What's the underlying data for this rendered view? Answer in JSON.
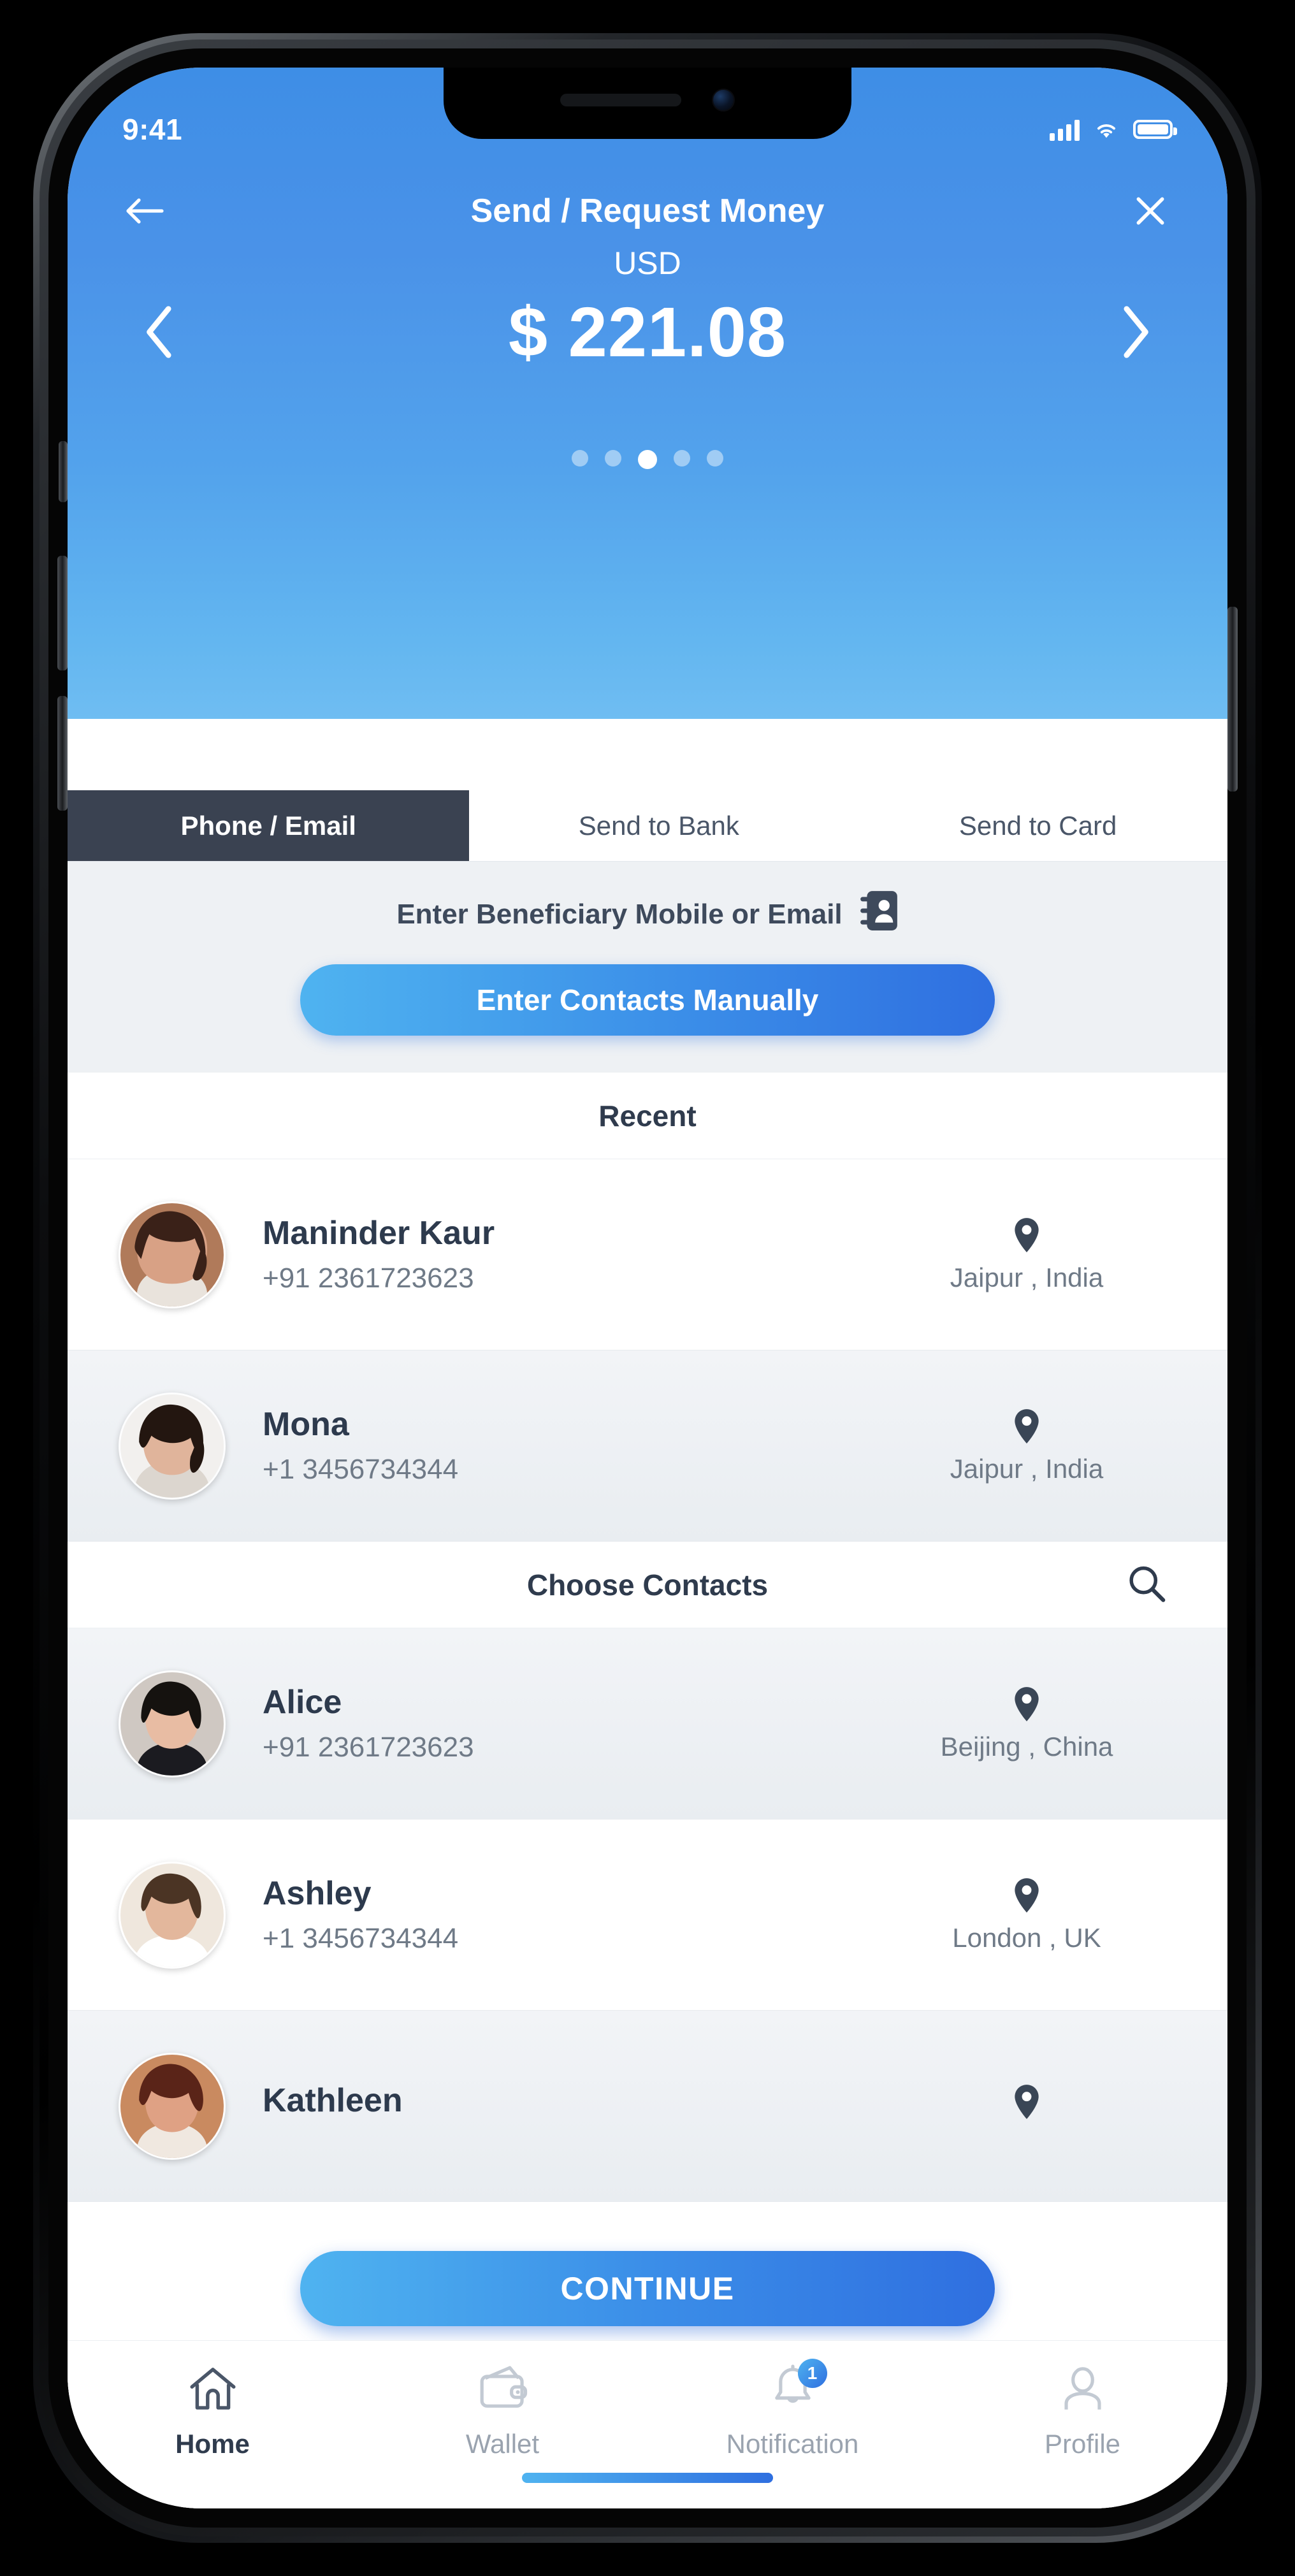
{
  "status_bar": {
    "time": "9:41",
    "signal_icon": "signal-bars-icon",
    "wifi_icon": "wifi-icon",
    "battery_icon": "battery-icon"
  },
  "header": {
    "back_icon": "back-arrow-icon",
    "title": "Send / Request Money",
    "close_icon": "close-icon",
    "currency": "USD",
    "amount": "$ 221.08",
    "prev_icon": "chevron-left-icon",
    "next_icon": "chevron-right-icon",
    "pager": {
      "count": 5,
      "active_index": 2
    },
    "accent": "#4a92e8"
  },
  "tabs": [
    {
      "label": "Phone / Email",
      "active": true
    },
    {
      "label": "Send to Bank",
      "active": false
    },
    {
      "label": "Send to Card",
      "active": false
    }
  ],
  "beneficiary": {
    "prompt": "Enter Beneficiary Mobile or Email",
    "contacts_icon": "address-book-icon",
    "manual_button": "Enter Contacts Manually"
  },
  "sections": {
    "recent_title": "Recent",
    "choose_title": "Choose Contacts",
    "search_icon": "search-icon"
  },
  "recent_contacts": [
    {
      "name": "Maninder Kaur",
      "phone": "+91 2361723623",
      "location": "Jaipur , India",
      "pin_icon": "map-pin-icon",
      "avatar": "avatar-woman-1"
    },
    {
      "name": "Mona",
      "phone": "+1 3456734344",
      "location": "Jaipur , India",
      "pin_icon": "map-pin-icon",
      "avatar": "avatar-woman-2"
    }
  ],
  "choose_contacts": [
    {
      "name": "Alice",
      "phone": "+91 2361723623",
      "location": "Beijing , China",
      "pin_icon": "map-pin-icon",
      "avatar": "avatar-woman-3"
    },
    {
      "name": "Ashley",
      "phone": "+1 3456734344",
      "location": "London , UK",
      "pin_icon": "map-pin-icon",
      "avatar": "avatar-woman-4"
    },
    {
      "name": "Kathleen",
      "phone": "",
      "location": "",
      "pin_icon": "map-pin-icon",
      "avatar": "avatar-woman-5"
    }
  ],
  "continue_button": {
    "label": "CONTINUE"
  },
  "bottom_nav": [
    {
      "label": "Home",
      "icon": "home-icon",
      "active": true,
      "badge": ""
    },
    {
      "label": "Wallet",
      "icon": "wallet-icon",
      "active": false,
      "badge": ""
    },
    {
      "label": "Notification",
      "icon": "bell-icon",
      "active": false,
      "badge": "1"
    },
    {
      "label": "Profile",
      "icon": "person-icon",
      "active": false,
      "badge": ""
    }
  ]
}
